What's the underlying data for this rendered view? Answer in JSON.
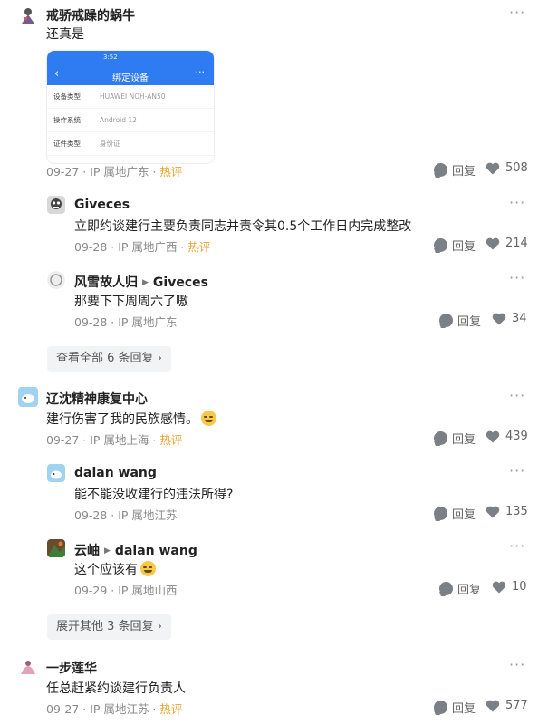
{
  "colors": {
    "hot": "#e8a330",
    "meta": "#8a8a8a",
    "icon": "#7b7f86",
    "shot_bar": "#2f7bf2"
  },
  "icons": {
    "reply": "reply-icon",
    "like": "heart-icon",
    "more": "more-icon",
    "arrow": "reply-arrow-icon"
  },
  "comments": [
    {
      "user": "戒骄戒躁的蜗牛",
      "text": "还真是",
      "meta": "09-27 · IP 属地广东 · ",
      "hot": "热评",
      "reply": "回复",
      "likes": "508",
      "screenshot": {
        "status": "3:52",
        "title": "绑定设备",
        "rows": [
          {
            "k": "设备类型",
            "v": "HUAWEI NOH-AN50"
          },
          {
            "k": "操作系统",
            "v": "Android 12"
          },
          {
            "k": "证件类型",
            "v": "身份证"
          }
        ]
      },
      "replies": [
        {
          "user": "Giveces",
          "text": "立即约谈建行主要负责同志并责令其0.5个工作日内完成整改",
          "meta": "09-28 · IP 属地广西 · ",
          "hot": "热评",
          "reply": "回复",
          "likes": "214"
        },
        {
          "user": "风雪故人归",
          "to": "Giveces",
          "text": "那要下下周周六了嗷",
          "meta": "09-28 · IP 属地广东",
          "reply": "回复",
          "likes": "34"
        }
      ],
      "view_more": "查看全部 6 条回复"
    },
    {
      "user": "辽沈精神康复中心",
      "text": "建行伤害了我的民族感情。",
      "meta": "09-27 · IP 属地上海 · ",
      "hot": "热评",
      "reply": "回复",
      "likes": "439",
      "replies": [
        {
          "user": "dalan wang",
          "text": "能不能没收建行的违法所得?",
          "meta": "09-28 · IP 属地江苏",
          "reply": "回复",
          "likes": "135"
        },
        {
          "user": "云岫",
          "to": "dalan wang",
          "text": "这个应该有",
          "meta": "09-29 · IP 属地山西",
          "reply": "回复",
          "likes": "10"
        }
      ],
      "view_more": "展开其他 3 条回复"
    },
    {
      "user": "一步莲华",
      "text": "任总赶紧约谈建行负责人",
      "meta": "09-27 · IP 属地江苏 · ",
      "hot": "热评",
      "reply": "回复",
      "likes": "577"
    }
  ]
}
